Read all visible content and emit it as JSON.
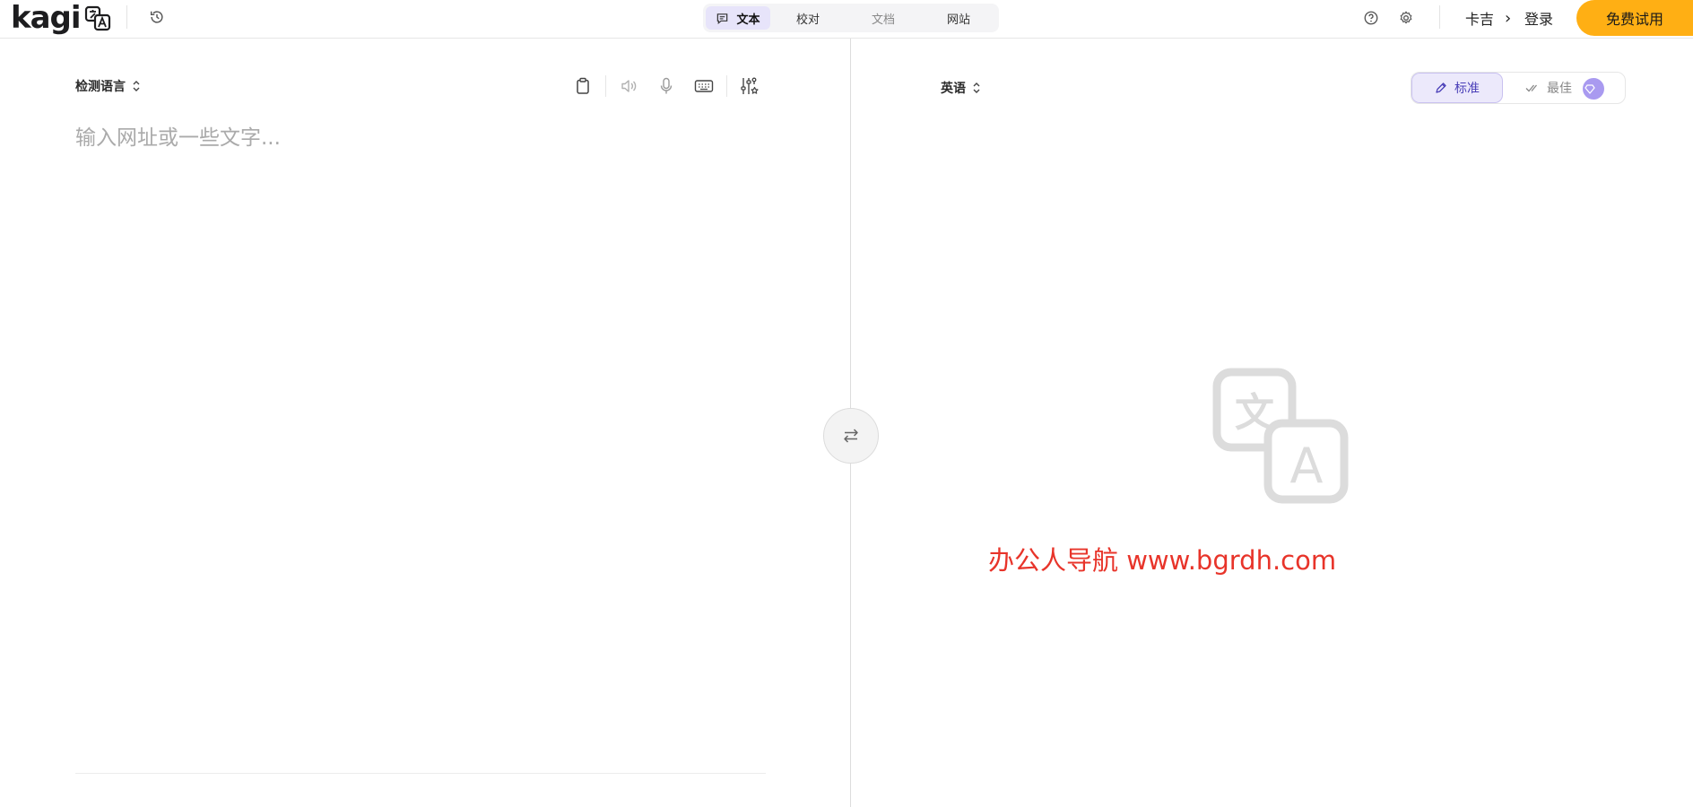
{
  "header": {
    "logo_text": "kagi",
    "history_icon": "history-icon",
    "mode_tabs": [
      {
        "label": "文本",
        "icon": "chat-icon",
        "active": true
      },
      {
        "label": "校对",
        "active": false
      },
      {
        "label": "文档",
        "active": false,
        "muted": true
      },
      {
        "label": "网站",
        "active": false
      }
    ],
    "help_icon": "help-icon",
    "settings_icon": "gear-icon",
    "breadcrumb_label": "卡吉",
    "breadcrumb_separator": "›",
    "login_label": "登录",
    "cta_label": "免费试用",
    "cta_color": "#ffaf14"
  },
  "source": {
    "language_label": "检测语言",
    "placeholder": "输入网址或一些文字...",
    "value": "",
    "tools": [
      "clipboard-icon",
      "speaker-icon",
      "microphone-icon",
      "keyboard-icon",
      "sliders-icon"
    ]
  },
  "swap_icon": "swap-arrows-icon",
  "target": {
    "language_label": "英语",
    "quality_options": [
      {
        "label": "标准",
        "icon": "pen-icon",
        "selected": true
      },
      {
        "label": "最佳",
        "icon": "double-check-icon",
        "selected": false
      }
    ],
    "accent_color": "#4a3fb8",
    "empty_icon": "translate-icon"
  },
  "watermark": "办公人导航 www.bgrdh.com"
}
